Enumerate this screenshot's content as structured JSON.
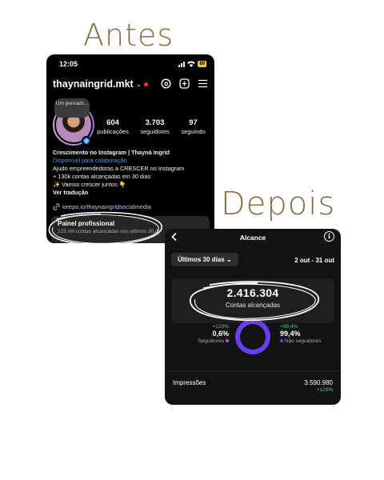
{
  "headings": {
    "before": "Antes",
    "after": "Depois"
  },
  "before": {
    "status_time": "12:05",
    "battery": "89",
    "username": "thaynaingrid.mkt",
    "note": "Um pensam...",
    "stats": [
      {
        "value": "604",
        "label": "publicações"
      },
      {
        "value": "3.703",
        "label": "seguidores"
      },
      {
        "value": "97",
        "label": "seguindo"
      }
    ],
    "bio": {
      "name": "Crescimento no Instagram | Thayná Ingrid",
      "availability": "Disponível para colaboração",
      "line1": "Ajudo empreendedoras a CRESCER no Instagram",
      "line2": "+ 130k contas alcançadas em 30 dias",
      "line3": "✨ Vamos crescer juntos 👇",
      "translate": "Ver tradução"
    },
    "link": "keepo.io/thaynaingridsocialmedia",
    "panel": {
      "title": "Painel profissional",
      "subtitle": "225 mil contas alcançadas nos últimos 30 di"
    }
  },
  "after": {
    "title": "Alcance",
    "filter": "Últimos 30 dias ⌄",
    "range": "2 out - 31 out",
    "reach_value": "2.416.304",
    "reach_label": "Contas alcançadas",
    "followers": {
      "change": "+129%",
      "pct": "0,6%",
      "label": "Seguidores",
      "color": "#c048e8"
    },
    "non_followers": {
      "change": "+99,4%",
      "pct": "99,4%",
      "label": "Não seguidores",
      "color": "#6a3df0"
    },
    "impressions": {
      "label": "Impressões",
      "value": "3.590.980",
      "change": "+120%"
    }
  }
}
